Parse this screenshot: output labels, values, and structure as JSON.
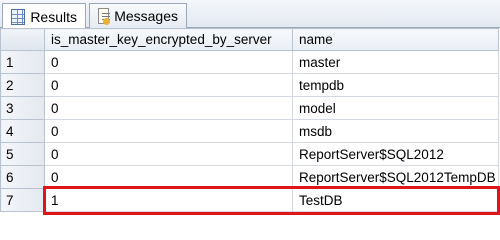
{
  "tabs": [
    {
      "label": "Results",
      "icon": "results-grid-icon",
      "active": true
    },
    {
      "label": "Messages",
      "icon": "messages-icon",
      "active": false
    }
  ],
  "grid": {
    "columns": [
      "is_master_key_encrypted_by_server",
      "name"
    ],
    "rows": [
      {
        "index": "1",
        "is_master_key_encrypted_by_server": "0",
        "name": "master"
      },
      {
        "index": "2",
        "is_master_key_encrypted_by_server": "0",
        "name": "tempdb"
      },
      {
        "index": "3",
        "is_master_key_encrypted_by_server": "0",
        "name": "model"
      },
      {
        "index": "4",
        "is_master_key_encrypted_by_server": "0",
        "name": "msdb"
      },
      {
        "index": "5",
        "is_master_key_encrypted_by_server": "0",
        "name": "ReportServer$SQL2012"
      },
      {
        "index": "6",
        "is_master_key_encrypted_by_server": "0",
        "name": "ReportServer$SQL2012TempDB"
      },
      {
        "index": "7",
        "is_master_key_encrypted_by_server": "1",
        "name": "TestDB"
      }
    ]
  },
  "colors": {
    "highlight_border": "#e0141b"
  }
}
